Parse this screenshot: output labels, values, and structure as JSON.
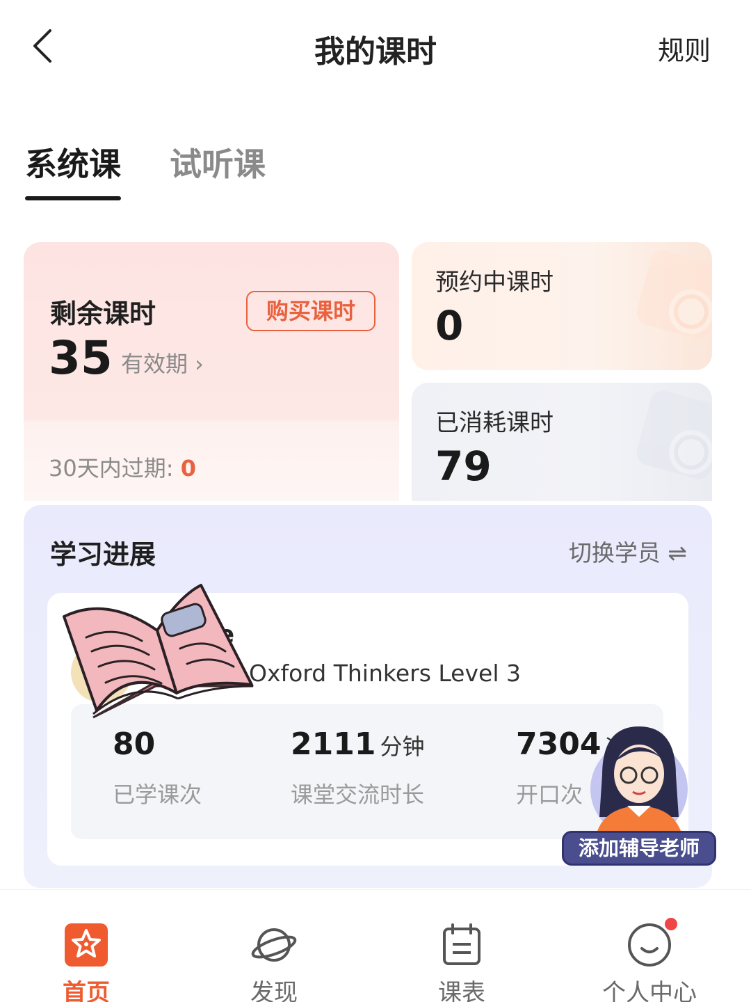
{
  "header": {
    "title": "我的课时",
    "rules_label": "规则"
  },
  "tabs": [
    {
      "label": "系统课",
      "active": true
    },
    {
      "label": "试听课",
      "active": false
    }
  ],
  "remaining": {
    "label": "剩余课时",
    "value": "35",
    "validity_label": "有效期 ›",
    "buy_label": "购买课时",
    "expire_label": "30天内过期: ",
    "expire_value": "0"
  },
  "booked": {
    "label": "预约中课时",
    "value": "0"
  },
  "used": {
    "label": "已消耗课时",
    "value": "79"
  },
  "progress": {
    "title": "学习进展",
    "switch_label": "切换学员 ⇌",
    "student_name_fragment": "e",
    "course_name": "Oxford Thinkers Level 3",
    "stats": [
      {
        "value": "80",
        "unit": "",
        "caption": "已学课次"
      },
      {
        "value": "2111",
        "unit": "分钟",
        "caption": "课堂交流时长"
      },
      {
        "value": "7304",
        "unit": "次",
        "caption": "开口次"
      }
    ]
  },
  "teacher_button": {
    "label": "添加辅导老师"
  },
  "bottom_nav": [
    {
      "label": "首页",
      "icon": "home-star-icon",
      "active": true
    },
    {
      "label": "发现",
      "icon": "planet-icon",
      "active": false
    },
    {
      "label": "课表",
      "icon": "calendar-icon",
      "active": false
    },
    {
      "label": "个人中心",
      "icon": "smiley-profile-icon",
      "active": false,
      "badge": true
    }
  ],
  "colors": {
    "accent": "#ef5a2f",
    "accent_outline": "#e8623f",
    "remaining_card_bg": "#fde4e2",
    "progress_bg": "#e9eafc",
    "teacher_button_bg": "#4a4e8e"
  }
}
